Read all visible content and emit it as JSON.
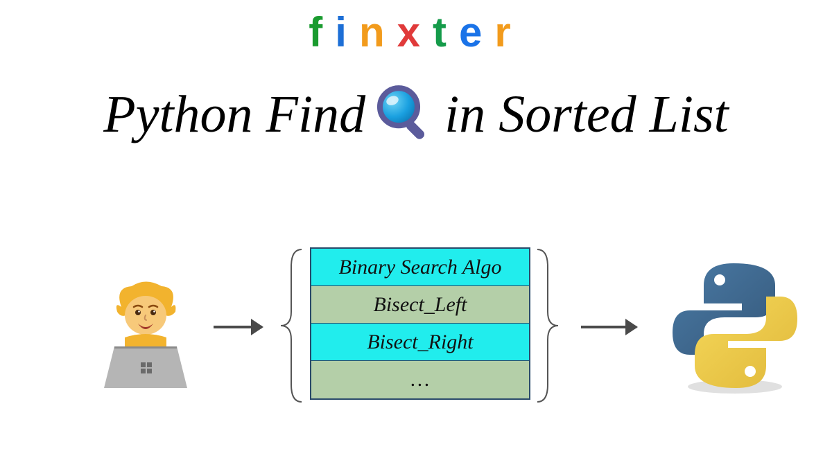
{
  "logo": {
    "letters": [
      {
        "char": "f",
        "color": "#1a9b2f"
      },
      {
        "char": "i",
        "color": "#1d6fd6"
      },
      {
        "char": "n",
        "color": "#f29b1c"
      },
      {
        "char": "x",
        "color": "#e03a3a"
      },
      {
        "char": "t",
        "color": "#159b4a"
      },
      {
        "char": "e",
        "color": "#1a73e8"
      },
      {
        "char": "r",
        "color": "#f29b1c"
      }
    ]
  },
  "title": {
    "left": "Python Find",
    "right": "in Sorted List"
  },
  "methods": [
    {
      "label": "Binary Search Algo",
      "style": "cyan"
    },
    {
      "label": "Bisect_Left",
      "style": "green"
    },
    {
      "label": "Bisect_Right",
      "style": "cyan"
    },
    {
      "label": "…",
      "style": "green"
    }
  ],
  "colors": {
    "mag_lens": "#1aa0e0",
    "mag_frame": "#5b5b9b",
    "python_blue": "#3f6a94",
    "python_yellow": "#f0cc4a"
  }
}
